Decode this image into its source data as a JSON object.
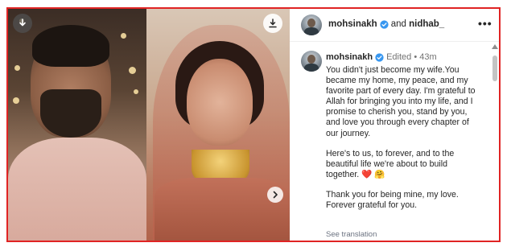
{
  "header": {
    "author": "mohsinakh",
    "connector": "and",
    "coauthor": "nidhab_",
    "more_label": "•••"
  },
  "comment": {
    "author": "mohsinakh",
    "status": "Edited",
    "separator": "•",
    "age": "43m",
    "paragraphs": [
      "You didn't just become my wife.You became my home, my peace, and my favorite part of every day. I'm grateful to Allah for bringing you into my life, and I promise to cherish you, stand by you, and love you through every chapter of our journey.",
      "Here's to us, to forever, and to the beautiful life we're about to build together.",
      "Thank you for being mine, my love. Forever grateful for you."
    ],
    "emoji": "❤️ 🤗",
    "see_translation": "See translation"
  },
  "icons": {
    "download_left": "download-icon",
    "download_right": "download-icon",
    "next": "chevron-right-icon",
    "verified": "verified-badge-icon",
    "more": "more-options-icon"
  },
  "colors": {
    "frame_border": "#e02424",
    "verified_blue": "#3897f0",
    "text": "#262626",
    "muted": "#737373",
    "heart": "#e0245e"
  }
}
